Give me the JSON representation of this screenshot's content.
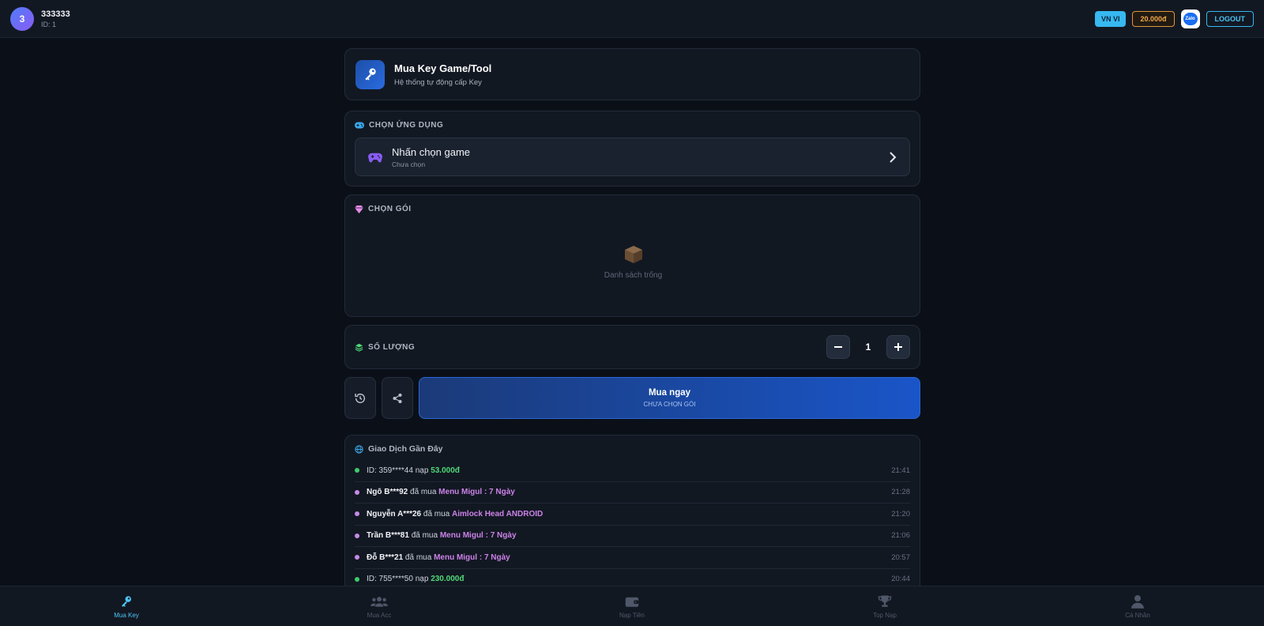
{
  "header": {
    "avatar_initial": "3",
    "username": "333333",
    "user_id": "ID: 1",
    "lang_label": "VN VI",
    "balance": "20.000đ",
    "zalo_label": "Zalo",
    "logout_label": "LOGOUT"
  },
  "hero": {
    "title": "Mua Key Game/Tool",
    "subtitle": "Hệ thống tự động cấp Key"
  },
  "app_select": {
    "label": "CHỌN ỨNG DỤNG",
    "title": "Nhấn chọn game",
    "status": "Chưa chọn"
  },
  "package": {
    "label": "CHỌN GÓI",
    "empty_text": "Danh sách trống"
  },
  "quantity": {
    "label": "SỐ LƯỢNG",
    "value": "1"
  },
  "buy": {
    "title": "Mua ngay",
    "subtitle": "CHƯA CHỌN GÓI"
  },
  "transactions": {
    "label": "Giao Dịch Gần Đây",
    "rows": [
      {
        "type": "deposit",
        "name": "ID: 359****44",
        "action": " nạp ",
        "value": "53.000đ",
        "time": "21:41"
      },
      {
        "type": "purchase",
        "name": "Ngô B***92",
        "action": " đã mua ",
        "value": "Menu Migul : 7 Ngày",
        "time": "21:28"
      },
      {
        "type": "purchase",
        "name": "Nguyễn A***26",
        "action": " đã mua ",
        "value": "Aimlock Head ANDROID",
        "time": "21:20"
      },
      {
        "type": "purchase",
        "name": "Trần B***81",
        "action": " đã mua ",
        "value": "Menu Migul : 7 Ngày",
        "time": "21:06"
      },
      {
        "type": "purchase",
        "name": "Đỗ B***21",
        "action": " đã mua ",
        "value": "Menu Migul : 7 Ngày",
        "time": "20:57"
      },
      {
        "type": "deposit",
        "name": "ID: 755****50",
        "action": " nạp ",
        "value": "230.000đ",
        "time": "20:44"
      }
    ]
  },
  "nav": [
    {
      "label": "Mua Key",
      "icon": "key-icon",
      "active": true
    },
    {
      "label": "Mua Acc",
      "icon": "users-icon",
      "active": false
    },
    {
      "label": "Nạp Tiền",
      "icon": "wallet-icon",
      "active": false
    },
    {
      "label": "Top Nạp",
      "icon": "trophy-icon",
      "active": false
    },
    {
      "label": "Cá Nhân",
      "icon": "user-icon",
      "active": false
    }
  ],
  "colors": {
    "background": "#0b1018",
    "card": "#121822",
    "accent": "#37b8f0",
    "balance": "#e0953a",
    "buy_button": "#1a55c8",
    "deposit": "#3ecb6a",
    "purchase": "#cc82e8"
  }
}
